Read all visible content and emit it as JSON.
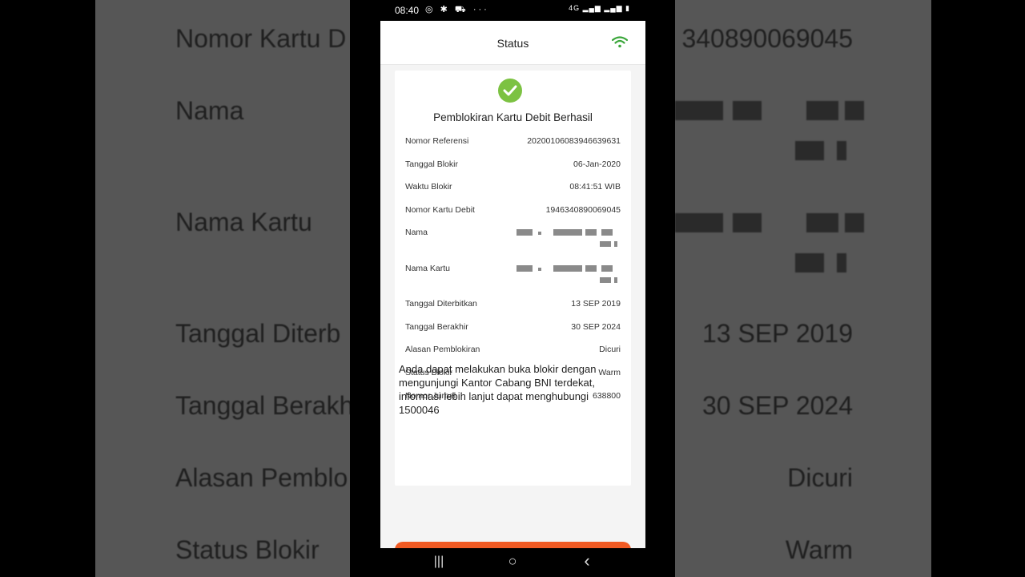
{
  "status_bar": {
    "time": "08:40",
    "left_icons": "◎ ✱ ⛟ ···",
    "right_icons": "4G ▂▄▆ ▂▄▆ ▮"
  },
  "app": {
    "title": "Status",
    "accent_color": "#7cc242"
  },
  "card": {
    "title": "Pemblokiran Kartu Debit Berhasil",
    "rows": [
      {
        "label": "Nomor Referensi",
        "value": "20200106083946639631"
      },
      {
        "label": "Tanggal Blokir",
        "value": "06-Jan-2020"
      },
      {
        "label": "Waktu Blokir",
        "value": "08:41:51 WIB"
      },
      {
        "label": "Nomor Kartu Debit",
        "value": "1946340890069045"
      },
      {
        "label": "Nama",
        "value": ""
      },
      {
        "label": "Nama Kartu",
        "value": ""
      },
      {
        "label": "Tanggal Diterbitkan",
        "value": "13 SEP 2019"
      },
      {
        "label": "Tanggal Berakhir",
        "value": "30 SEP 2024"
      },
      {
        "label": "Alasan Pemblokiran",
        "value": "Dicuri"
      },
      {
        "label": "Status Blokir",
        "value": "Warm"
      },
      {
        "label": "Nomor Jurnal",
        "value": "638800"
      }
    ],
    "note": "Anda dapat melakukan buka blokir dengan mengunjungi Kantor Cabang BNI terdekat, informasi lebih lanjut dapat menghubungi 1500046"
  },
  "background": {
    "left": [
      "Nomor Kartu D",
      "Nama",
      "Nama Kartu",
      "Tanggal Diterb",
      "Tanggal Berakh",
      "Alasan Pemblo",
      "Status Blokir"
    ],
    "right": [
      "340890069045",
      "13 SEP 2019",
      "30 SEP 2024",
      "Dicuri",
      "Warm"
    ]
  },
  "nav": {
    "recent": "|||",
    "home": "○",
    "back": "‹"
  }
}
